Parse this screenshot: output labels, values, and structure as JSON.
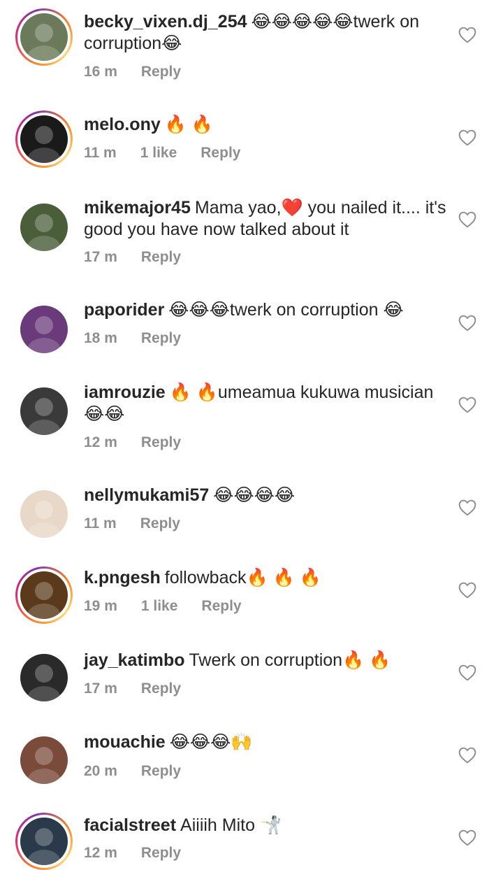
{
  "comments": [
    {
      "username": "becky_vixen.dj_254",
      "text": "😂😂😂😂😂twerk on corruption😂",
      "time": "16 m",
      "likes": "",
      "reply": "Reply",
      "story_ring": true,
      "avatar_color": "#6b7a5a"
    },
    {
      "username": "melo.ony",
      "text": "🔥 🔥",
      "time": "11 m",
      "likes": "1 like",
      "reply": "Reply",
      "story_ring": true,
      "avatar_color": "#1a1a1a"
    },
    {
      "username": "mikemajor45",
      "text": "Mama yao,❤️ you nailed it.... it's good you have now talked about it",
      "time": "17 m",
      "likes": "",
      "reply": "Reply",
      "story_ring": false,
      "avatar_color": "#4a5e3a"
    },
    {
      "username": "paporider",
      "text": "😂😂😂twerk on corruption 😂",
      "time": "18 m",
      "likes": "",
      "reply": "Reply",
      "story_ring": false,
      "avatar_color": "#6a3a7a"
    },
    {
      "username": "iamrouzie",
      "text": "🔥 🔥umeamua kukuwa musician 😂😂",
      "time": "12 m",
      "likes": "",
      "reply": "Reply",
      "story_ring": false,
      "avatar_color": "#3a3a3a"
    },
    {
      "username": "nellymukami57",
      "text": "😂😂😂😂",
      "time": "11 m",
      "likes": "",
      "reply": "Reply",
      "story_ring": false,
      "avatar_color": "#e8d8c8"
    },
    {
      "username": "k.pngesh",
      "text": "followback🔥 🔥 🔥",
      "time": "19 m",
      "likes": "1 like",
      "reply": "Reply",
      "story_ring": true,
      "avatar_color": "#5a3a1a"
    },
    {
      "username": "jay_katimbo",
      "text": "Twerk on corruption🔥 🔥",
      "time": "17 m",
      "likes": "",
      "reply": "Reply",
      "story_ring": false,
      "avatar_color": "#2a2a2a"
    },
    {
      "username": "mouachie",
      "text": "😂😂😂🙌",
      "time": "20 m",
      "likes": "",
      "reply": "Reply",
      "story_ring": false,
      "avatar_color": "#7a4a3a"
    },
    {
      "username": "facialstreet",
      "text": "Aiiiih Mito 🤺",
      "time": "12 m",
      "likes": "",
      "reply": "Reply",
      "story_ring": true,
      "avatar_color": "#2a3a4a"
    }
  ]
}
